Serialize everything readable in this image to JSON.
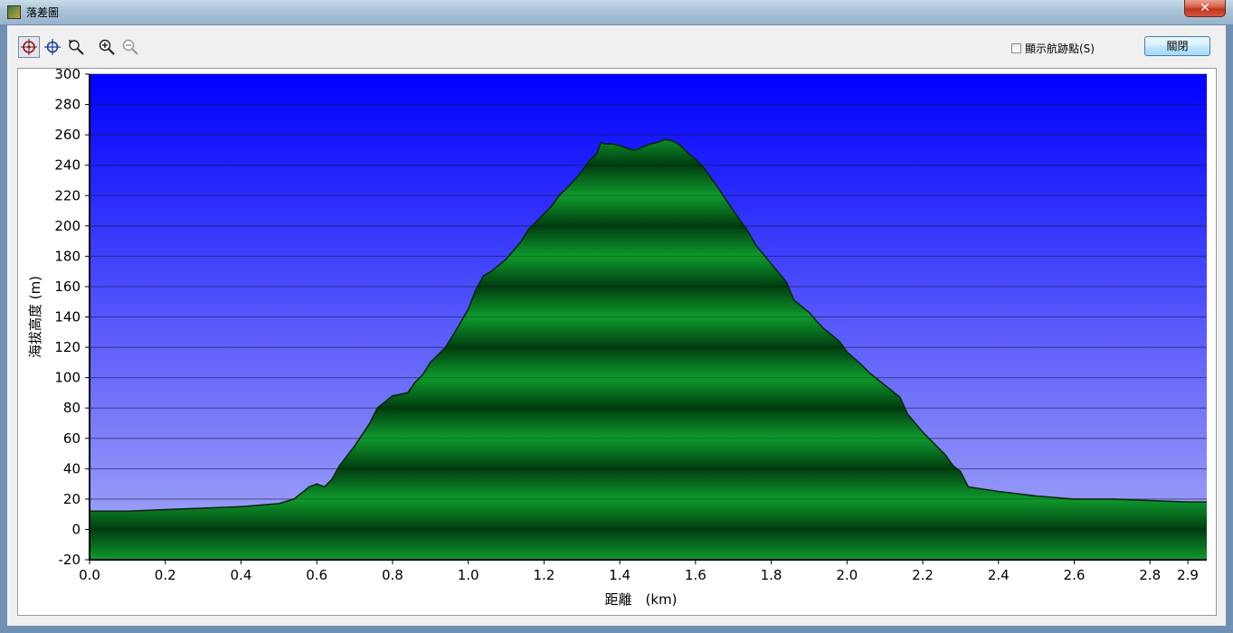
{
  "window": {
    "title": "落差圖",
    "close_glyph": "✕"
  },
  "toolbar": {
    "tools": [
      {
        "icon": "target-select-icon",
        "active": true
      },
      {
        "icon": "crosshair-icon",
        "active": false
      },
      {
        "icon": "magnifier-pointer-icon",
        "active": false
      },
      {
        "icon": "zoom-in-icon",
        "active": false
      },
      {
        "icon": "zoom-out-icon",
        "active": false
      }
    ],
    "show_waypoints_label": "顯示航跡點(S)",
    "show_waypoints_checked": false,
    "close_label": "關閉"
  },
  "colors": {
    "sky_top": "#0000ff",
    "sky_bottom": "#a9acf6",
    "terrain_light": "#0f9a2d",
    "terrain_dark": "#003d0f",
    "outline": "#0a2a0a"
  },
  "chart_data": {
    "type": "area",
    "xlabel": "距離　(km)",
    "ylabel": "海拔高度 (m)",
    "xlim": [
      0,
      2.95
    ],
    "ylim": [
      -20,
      300
    ],
    "x_ticks": [
      "0.0",
      "0.2",
      "0.4",
      "0.6",
      "0.8",
      "1.0",
      "1.2",
      "1.4",
      "1.6",
      "1.8",
      "2.0",
      "2.2",
      "2.4",
      "2.6",
      "2.8",
      "2.9"
    ],
    "y_ticks": [
      "300",
      "280",
      "260",
      "240",
      "220",
      "200",
      "180",
      "160",
      "140",
      "120",
      "100",
      "80",
      "60",
      "40",
      "20",
      "0",
      "-20"
    ],
    "grid": true,
    "x": [
      0.0,
      0.1,
      0.2,
      0.3,
      0.4,
      0.5,
      0.54,
      0.58,
      0.6,
      0.62,
      0.64,
      0.66,
      0.7,
      0.74,
      0.76,
      0.8,
      0.84,
      0.86,
      0.88,
      0.9,
      0.94,
      0.96,
      1.0,
      1.02,
      1.04,
      1.06,
      1.1,
      1.14,
      1.16,
      1.2,
      1.22,
      1.24,
      1.26,
      1.28,
      1.3,
      1.32,
      1.34,
      1.35,
      1.36,
      1.38,
      1.4,
      1.42,
      1.44,
      1.46,
      1.48,
      1.5,
      1.52,
      1.54,
      1.56,
      1.58,
      1.6,
      1.62,
      1.64,
      1.66,
      1.7,
      1.74,
      1.76,
      1.8,
      1.84,
      1.86,
      1.9,
      1.92,
      1.94,
      1.98,
      2.0,
      2.04,
      2.06,
      2.1,
      2.14,
      2.16,
      2.2,
      2.24,
      2.26,
      2.28,
      2.3,
      2.32,
      2.4,
      2.5,
      2.6,
      2.7,
      2.8,
      2.9,
      2.95
    ],
    "y": [
      12,
      12,
      13,
      14,
      15,
      17,
      20,
      28,
      30,
      28,
      33,
      42,
      55,
      70,
      80,
      88,
      90,
      97,
      102,
      110,
      120,
      128,
      145,
      158,
      167,
      170,
      178,
      190,
      198,
      208,
      213,
      220,
      225,
      230,
      236,
      243,
      248,
      255,
      254,
      254,
      253,
      251,
      250,
      252,
      254,
      255,
      257,
      256,
      253,
      248,
      244,
      239,
      232,
      225,
      210,
      196,
      187,
      175,
      163,
      151,
      143,
      137,
      132,
      124,
      117,
      108,
      103,
      95,
      87,
      76,
      64,
      54,
      49,
      42,
      38,
      28,
      25,
      22,
      20,
      20,
      19,
      18,
      18
    ]
  }
}
